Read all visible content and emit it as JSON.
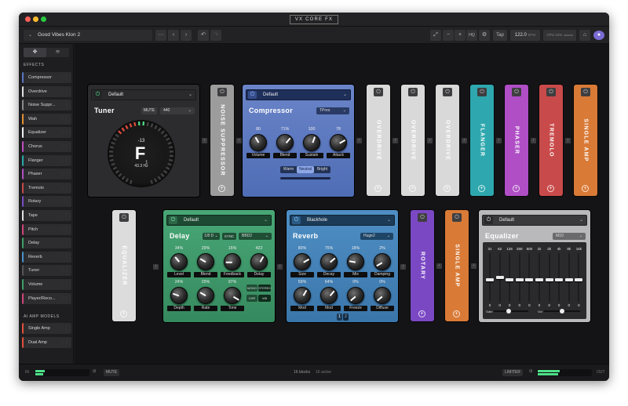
{
  "window": {
    "title": "VX CORE FX"
  },
  "toolbar": {
    "preset_name": "Good Vibes Klon 2",
    "more": "···",
    "prev": "‹",
    "next": "›",
    "undo": "↶",
    "redo": "↷",
    "minus": "−",
    "plus": "+",
    "hq": "HQ",
    "tap": "Tap",
    "tempo": "122.0",
    "tempo_unit": "BPM",
    "cpu": "12%"
  },
  "sidebar": {
    "effects_heading": "EFFECTS",
    "effects": [
      {
        "label": "Compressor",
        "color": "#5a76c2"
      },
      {
        "label": "Overdrive",
        "color": "#e0e0e0"
      },
      {
        "label": "Noise Suppr...",
        "color": "#8a8a8a"
      },
      {
        "label": "Wah",
        "color": "#e39132"
      },
      {
        "label": "Equalizer",
        "color": "#f0f0f0"
      },
      {
        "label": "Chorus",
        "color": "#c04dc0"
      },
      {
        "label": "Flanger",
        "color": "#2aa8a8"
      },
      {
        "label": "Phaser",
        "color": "#b24fc0"
      },
      {
        "label": "Tremolo",
        "color": "#c8484a"
      },
      {
        "label": "Rotary",
        "color": "#7a4cc4"
      },
      {
        "label": "Tape",
        "color": "#e0e0e0"
      },
      {
        "label": "Pitch",
        "color": "#d0457a"
      },
      {
        "label": "Delay",
        "color": "#3ea066"
      },
      {
        "label": "Reverb",
        "color": "#4a90c8"
      },
      {
        "label": "Tuner",
        "color": "#555555"
      },
      {
        "label": "Volume",
        "color": "#3ea066"
      },
      {
        "label": "Player/Reco...",
        "color": "#d0457a"
      }
    ],
    "amp_heading": "AI AMP MODELS",
    "amps": [
      {
        "label": "Single Amp",
        "color": "#e0503c"
      },
      {
        "label": "Dual Amp",
        "color": "#e0503c"
      }
    ]
  },
  "row1": {
    "tuner": {
      "preset": "Default",
      "title": "Tuner",
      "mute": "MUTE",
      "ref": "440",
      "cents": "-13",
      "note": "F",
      "octave": "1",
      "freq": "43.3 Hz"
    },
    "strips_a": [
      {
        "label": "NOISE SUPPRESSOR",
        "color": "#9c9c9c",
        "text": "#ffffff"
      }
    ],
    "compressor": {
      "preset": "Default",
      "title": "Compressor",
      "model": "TPres",
      "knobs": [
        {
          "value": "80",
          "label": "Volume",
          "rot": -30
        },
        {
          "value": "71%",
          "label": "Blend",
          "rot": 40
        },
        {
          "value": "100",
          "label": "Sustain",
          "rot": 20
        },
        {
          "value": "78",
          "label": "Attack",
          "rot": 60
        }
      ],
      "modes": [
        "Warm",
        "Neutral",
        "Bright"
      ],
      "active_mode": "Neutral"
    },
    "strips_b": [
      {
        "label": "OVERDRIVE",
        "color": "#d9d9d9",
        "text": "#ffffff"
      },
      {
        "label": "OVERDRIVE",
        "color": "#d9d9d9",
        "text": "#ffffff"
      },
      {
        "label": "OVERDRIVE",
        "color": "#d9d9d9",
        "text": "#ffffff"
      },
      {
        "label": "FLANGER",
        "color": "#2ea8ae",
        "text": "#ffffff"
      },
      {
        "label": "PHASER",
        "color": "#b04ec6",
        "text": "#ffffff"
      },
      {
        "label": "TREMOLO",
        "color": "#c94a4a",
        "text": "#ffffff"
      },
      {
        "label": "SINGLE AMP",
        "color": "#d97a36",
        "text": "#ffffff"
      }
    ]
  },
  "row2": {
    "strip_eq": {
      "label": "EQUALIZER",
      "color": "#dcdcdc",
      "text": "#ffffff"
    },
    "delay": {
      "preset": "Default",
      "title": "Delay",
      "division": "1/8 D",
      "sync": "SYNC",
      "model": "BBD2",
      "knobs": [
        {
          "value": "34%",
          "label": "Level",
          "rot": -40
        },
        {
          "value": "29%",
          "label": "Blend",
          "rot": -60
        },
        {
          "value": "15%",
          "label": "Feedback",
          "rot": -90
        },
        {
          "value": "422",
          "label": "Delay",
          "rot": 30
        },
        {
          "value": "24%",
          "label": "Depth",
          "rot": -70
        },
        {
          "value": "29%",
          "label": "Rate",
          "rot": -60
        },
        {
          "value": "97%",
          "label": "Tone",
          "rot": 120
        }
      ],
      "mono": "MONO",
      "stereo": "STEREO",
      "chr": "CHR",
      "vib": "VIB"
    },
    "reverb": {
      "preset": "Blackhole",
      "title": "Reverb",
      "model": "Huge2",
      "knobs": [
        {
          "value": "80%",
          "label": "Size",
          "rot": 60
        },
        {
          "value": "75%",
          "label": "Decay",
          "rot": 50
        },
        {
          "value": "18%",
          "label": "Mix",
          "rot": -80
        },
        {
          "value": "2%",
          "label": "Damping",
          "rot": -120
        },
        {
          "value": "59%",
          "label": "Mod",
          "rot": 30
        },
        {
          "value": "64%",
          "label": "Mod",
          "rot": 40
        },
        {
          "value": "0%",
          "label": "Freeze",
          "rot": -130
        },
        {
          "value": "0%",
          "label": "Diffuse",
          "rot": -130
        }
      ],
      "pages": [
        "1",
        "2"
      ]
    },
    "strips": [
      {
        "label": "ROTARY",
        "color": "#7b48c4",
        "text": "#ffffff"
      },
      {
        "label": "SINGLE AMP",
        "color": "#d97a36",
        "text": "#ffffff"
      }
    ],
    "equalizer": {
      "preset": "Default",
      "title": "Equalizer",
      "model": "M10",
      "bands": [
        {
          "f": "31",
          "lvl": 0.45
        },
        {
          "f": "62",
          "lvl": 0.5
        },
        {
          "f": "125",
          "lvl": 0.45
        },
        {
          "f": "250",
          "lvl": 0.45
        },
        {
          "f": "500",
          "lvl": 0.45
        },
        {
          "f": "1k",
          "lvl": 0.45
        },
        {
          "f": "2k",
          "lvl": 0.45
        },
        {
          "f": "4k",
          "lvl": 0.45
        },
        {
          "f": "8k",
          "lvl": 0.45
        },
        {
          "f": "16k",
          "lvl": 0.45
        }
      ],
      "values": [
        "0",
        "0",
        "0",
        "0",
        "0",
        "0",
        "0",
        "0",
        "0",
        "0"
      ],
      "gain_label": "Gain",
      "vol_label": "Vol"
    }
  },
  "status": {
    "mute": "MUTE",
    "blocks": "16 blocks",
    "active": "16 active",
    "limiter": "LIMITER",
    "in_label": "IN",
    "out_label": "OUT"
  }
}
